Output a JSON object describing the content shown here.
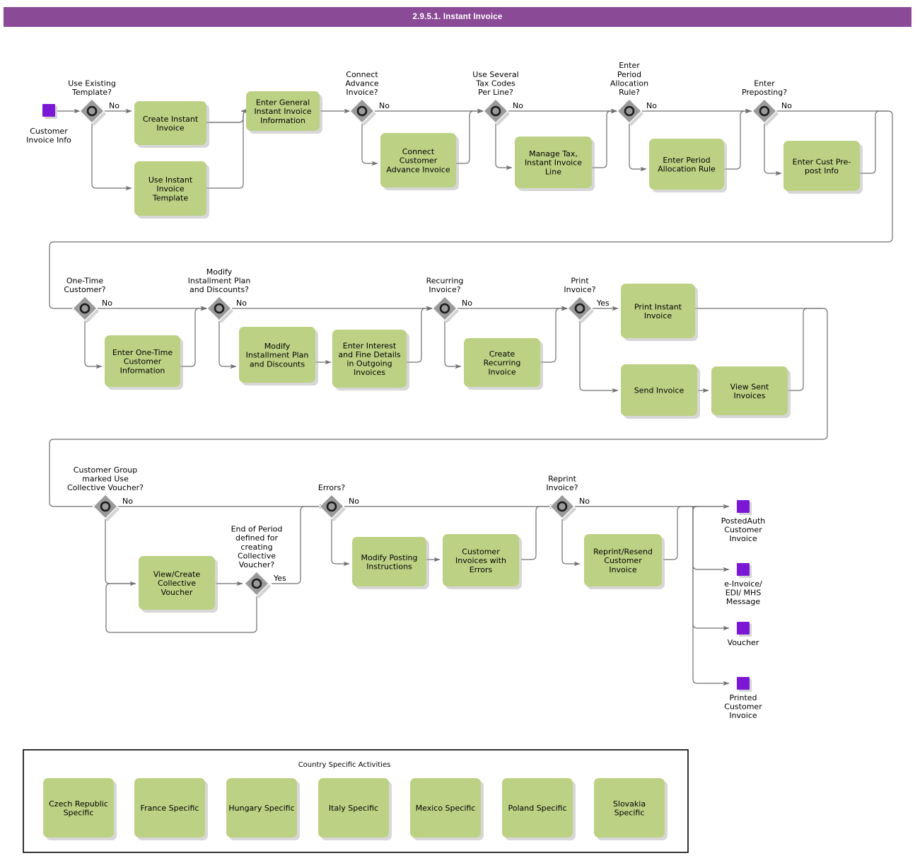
{
  "header": {
    "title": "2.9.5.1. Instant Invoice",
    "bar_color": "#8A4A96"
  },
  "colors": {
    "task_fill": "#BDD184",
    "gateway_fill": "#9A9A9A",
    "event_fill": "#7B18D6",
    "flow_line": "#6F6F6F"
  },
  "diagram": {
    "type": "bpmn-flowchart",
    "start_events": [
      {
        "id": "start1",
        "label": "Customer\nInvoice Info"
      }
    ],
    "end_events": [
      {
        "id": "end1",
        "label": "PostedAuth\nCustomer\nInvoice"
      },
      {
        "id": "end2",
        "label": "e-Invoice/\nEDI/ MHS\nMessage"
      },
      {
        "id": "end3",
        "label": "Voucher"
      },
      {
        "id": "end4",
        "label": "Printed\nCustomer\nInvoice"
      }
    ],
    "gateways": [
      {
        "id": "gw1",
        "label": "Use Existing\nTemplate?",
        "branch": "No"
      },
      {
        "id": "gw2",
        "label": "Connect\nAdvance\nInvoice?",
        "branch": "No"
      },
      {
        "id": "gw3",
        "label": "Use Several\nTax Codes\nPer Line?",
        "branch": "No"
      },
      {
        "id": "gw4",
        "label": "Enter\nPeriod\nAllocation\nRule?",
        "branch": "No"
      },
      {
        "id": "gw5",
        "label": "Enter\nPreposting?",
        "branch": "No"
      },
      {
        "id": "gw6",
        "label": "One-Time\nCustomer?",
        "branch": "No"
      },
      {
        "id": "gw7",
        "label": "Modify\nInstallment Plan\nand Discounts?",
        "branch": "No"
      },
      {
        "id": "gw8",
        "label": "Recurring\nInvoice?",
        "branch": "No"
      },
      {
        "id": "gw9",
        "label": "Print\nInvoice?",
        "branch": "Yes"
      },
      {
        "id": "gw10",
        "label": "Customer Group\nmarked Use\nCollective Voucher?",
        "branch": "No"
      },
      {
        "id": "gw11",
        "label": "End of Period\ndefined for\ncreating\nCollective\nVoucher?",
        "branch": "Yes"
      },
      {
        "id": "gw12",
        "label": "Errors?",
        "branch": "No"
      },
      {
        "id": "gw13",
        "label": "Reprint\nInvoice?",
        "branch": "No"
      }
    ],
    "tasks": [
      {
        "id": "t1",
        "label": "Create Instant\nInvoice"
      },
      {
        "id": "t2",
        "label": "Use Instant\nInvoice\nTemplate"
      },
      {
        "id": "t3",
        "label": "Enter General\nInstant Invoice\nInformation"
      },
      {
        "id": "t4",
        "label": "Connect\nCustomer\nAdvance Invoice"
      },
      {
        "id": "t5",
        "label": "Manage Tax,\nInstant Invoice\nLine"
      },
      {
        "id": "t6",
        "label": "Enter Period\nAllocation Rule"
      },
      {
        "id": "t7",
        "label": "Enter Cust Pre-\npost Info"
      },
      {
        "id": "t8",
        "label": "Enter One-Time\nCustomer\nInformation"
      },
      {
        "id": "t9",
        "label": "Modify\nInstallment Plan\nand Discounts"
      },
      {
        "id": "t10",
        "label": "Enter Interest\nand Fine Details\nin Outgoing\nInvoices"
      },
      {
        "id": "t11",
        "label": "Create\nRecurring\nInvoice"
      },
      {
        "id": "t12",
        "label": "Print Instant\nInvoice"
      },
      {
        "id": "t13",
        "label": "Send Invoice"
      },
      {
        "id": "t14",
        "label": "View Sent\nInvoices"
      },
      {
        "id": "t15",
        "label": "View/Create\nCollective\nVoucher"
      },
      {
        "id": "t16",
        "label": "Modify Posting\nInstructions"
      },
      {
        "id": "t17",
        "label": "Customer\nInvoices with\nErrors"
      },
      {
        "id": "t18",
        "label": "Reprint/Resend\nCustomer\nInvoice"
      }
    ],
    "country_group": {
      "title": "Country Specific Activities",
      "items": [
        {
          "id": "c1",
          "label": "Czech Republic\nSpecific"
        },
        {
          "id": "c2",
          "label": "France Specific"
        },
        {
          "id": "c3",
          "label": "Hungary Specific"
        },
        {
          "id": "c4",
          "label": "Italy Specific"
        },
        {
          "id": "c5",
          "label": "Mexico Specific"
        },
        {
          "id": "c6",
          "label": "Poland Specific"
        },
        {
          "id": "c7",
          "label": "Slovakia\nSpecific"
        }
      ]
    }
  }
}
